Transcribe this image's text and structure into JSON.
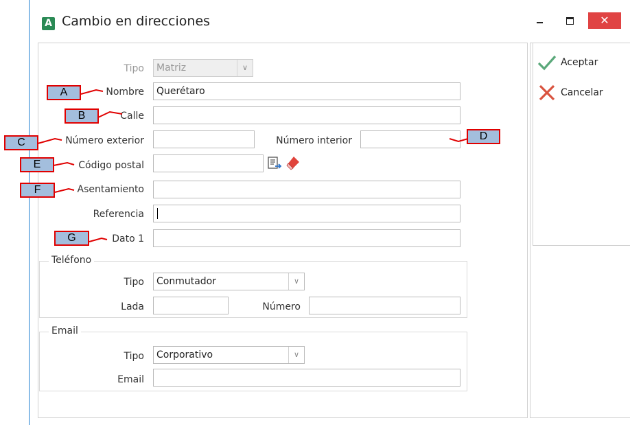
{
  "window": {
    "app_icon_letter": "A",
    "title": "Cambio en direcciones",
    "close_glyph": "✕"
  },
  "actions": {
    "accept_label": "Aceptar",
    "cancel_label": "Cancelar"
  },
  "form": {
    "tipo_label": "Tipo",
    "tipo_value": "Matriz",
    "nombre_label": "Nombre",
    "nombre_value": "Querétaro",
    "calle_label": "Calle",
    "calle_value": "",
    "num_ext_label": "Número exterior",
    "num_ext_value": "",
    "num_int_label": "Número interior",
    "num_int_value": "",
    "cp_label": "Código postal",
    "cp_value": "",
    "asentamiento_label": "Asentamiento",
    "asentamiento_value": "",
    "referencia_label": "Referencia",
    "referencia_value": "",
    "dato1_label": "Dato 1",
    "dato1_value": ""
  },
  "telefono": {
    "legend": "Teléfono",
    "tipo_label": "Tipo",
    "tipo_value": "Conmutador",
    "lada_label": "Lada",
    "lada_value": "",
    "numero_label": "Número",
    "numero_value": ""
  },
  "email": {
    "legend": "Email",
    "tipo_label": "Tipo",
    "tipo_value": "Corporativo",
    "email_label": "Email",
    "email_value": ""
  },
  "annotations": {
    "a": "A",
    "b": "B",
    "c": "C",
    "d": "D",
    "e": "E",
    "f": "F",
    "g": "G"
  },
  "icons": {
    "dropdown": "chevron-down-icon",
    "lookup": "document-lookup-icon",
    "clear": "eraser-icon",
    "accept": "checkmark-icon",
    "cancel": "x-mark-icon"
  },
  "colors": {
    "accept": "#5aa87a",
    "cancel": "#d9533f",
    "annotation_fill": "#a3bedd",
    "annotation_border": "#e00000",
    "close_button": "#e04343",
    "app_icon": "#2a8a55"
  }
}
